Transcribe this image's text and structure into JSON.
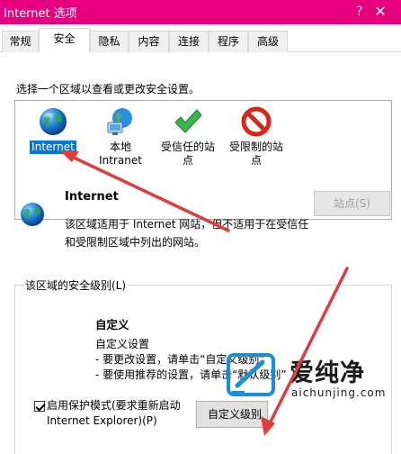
{
  "window": {
    "title": "Internet 选项",
    "help_glyph": "?",
    "close_glyph": "✕"
  },
  "tabs": [
    {
      "label": "常规"
    },
    {
      "label": "安全",
      "active": true
    },
    {
      "label": "隐私"
    },
    {
      "label": "内容"
    },
    {
      "label": "连接"
    },
    {
      "label": "程序"
    },
    {
      "label": "高级"
    }
  ],
  "security": {
    "instruction": "选择一个区域以查看或更改安全设置。",
    "zones": [
      {
        "line1": "Internet",
        "line2": "",
        "icon": "globe-icon",
        "selected": true
      },
      {
        "line1": "本地",
        "line2": "Intranet",
        "icon": "intranet-icon"
      },
      {
        "line1": "受信任的站",
        "line2": "点",
        "icon": "checkmark-icon"
      },
      {
        "line1": "受限制的站",
        "line2": "点",
        "icon": "prohibited-icon"
      }
    ],
    "sites_button": "站点(S)",
    "zone_name": "Internet",
    "zone_desc_line1": "该区域适用于 Internet 网站，但不适用于在受信任",
    "zone_desc_line2": "和受限制区域中列出的网站。",
    "level_legend": "该区域的安全级别(L)",
    "level_name": "自定义",
    "level_lines": [
      "自定义设置",
      " - 要更改设置，请单击“自定义级别”",
      " - 要使用推荐的设置，请单击“默认级别”"
    ],
    "protected_mode_line1": "启用保护模式(要求重新启动",
    "protected_mode_line2": "Internet Explorer)(P)",
    "protected_mode_checked": true,
    "custom_level_button": "自定义级别(C)..."
  },
  "watermark": {
    "name": "爱纯净",
    "url": "aichunjing.com"
  },
  "colors": {
    "title_bar": "#e6007e",
    "selection": "#0078d7",
    "arrow": "#e03c3c"
  }
}
